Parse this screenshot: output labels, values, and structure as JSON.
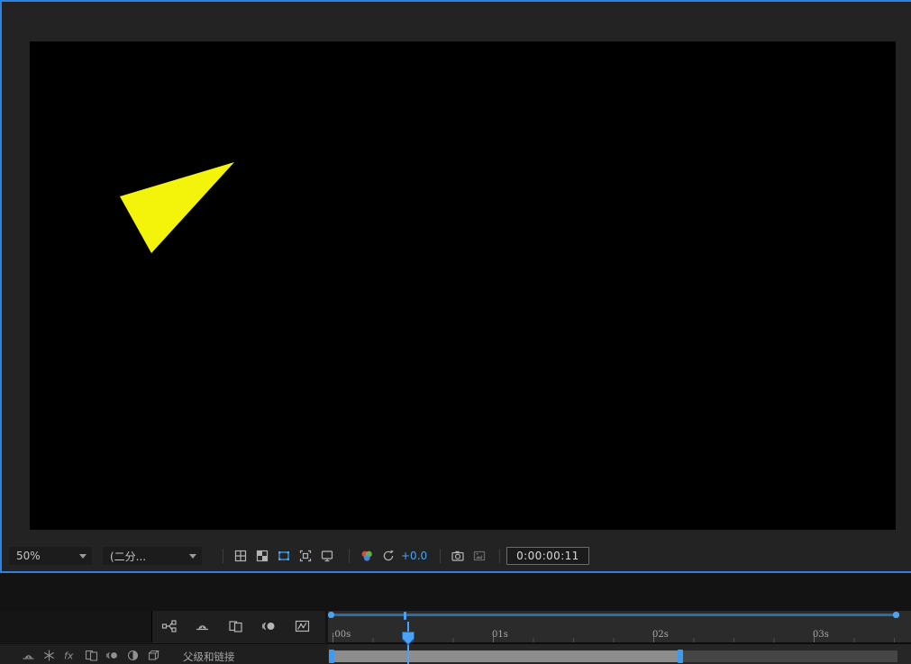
{
  "colors": {
    "accent_blue": "#4aa3f5",
    "panel_border_blue": "#2f82dd",
    "triangle_yellow": "#f4f40a"
  },
  "composition": {
    "triangle_points": "227,134 100,172 135,235",
    "triangle_color": "#f4f40a"
  },
  "viewer_toolbar": {
    "zoom_value": "50%",
    "resolution_value": "(二分...",
    "exposure_value": "+0.0",
    "timecode": "0:00:00:11"
  },
  "timeline": {
    "ruler_labels": [
      ":00s",
      "01s",
      "02s",
      "03s"
    ],
    "parent_link_label": "父级和链接",
    "fx_label": "fx"
  }
}
